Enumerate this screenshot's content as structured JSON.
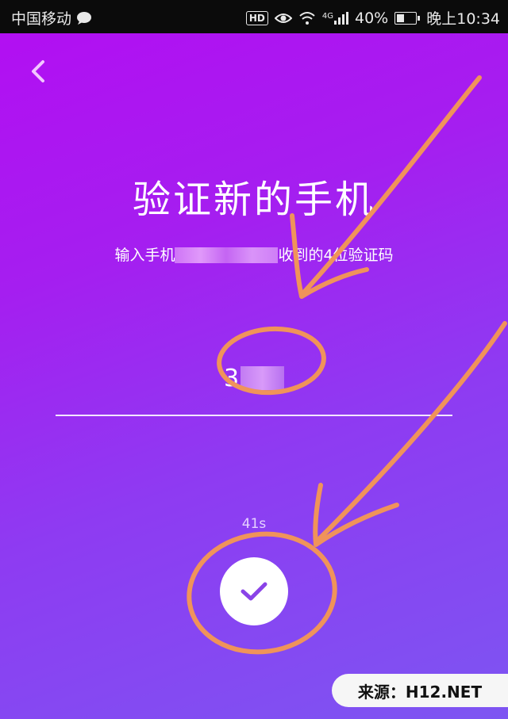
{
  "status_bar": {
    "carrier": "中国移动",
    "hd_badge": "HD",
    "network": "4G",
    "battery_percent": "40%",
    "battery_level": 0.4,
    "time": "晚上10:34"
  },
  "page": {
    "title": "验证新的手机",
    "subtitle_prefix": "输入手机",
    "subtitle_suffix": "收到的4位验证码",
    "code_visible": "3",
    "countdown": "41s"
  },
  "icons": {
    "back": "chevron-left-icon",
    "confirm": "check-icon",
    "message": "message-bubble-icon",
    "eye": "eye-icon",
    "wifi": "wifi-icon",
    "signal": "signal-icon",
    "battery": "battery-icon"
  },
  "colors": {
    "gradient_top": "#b20ff2",
    "gradient_bottom": "#7d55f2",
    "annotation": "#f0935a",
    "check": "#8a43e8"
  },
  "watermark": "来源：H12.NET"
}
